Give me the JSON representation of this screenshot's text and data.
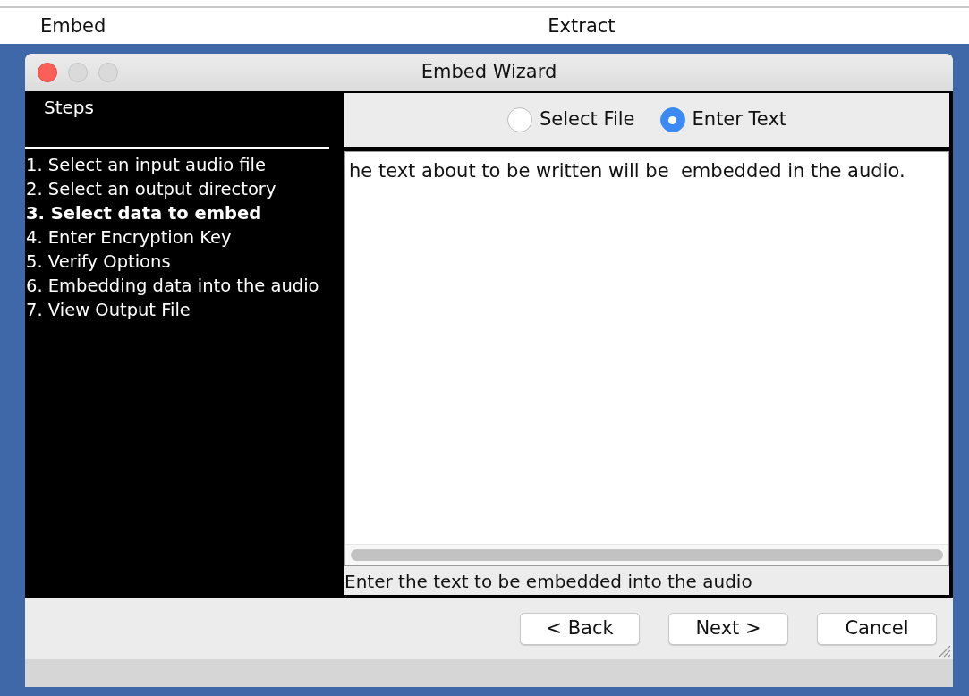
{
  "tabs": [
    {
      "label": "Embed"
    },
    {
      "label": "Extract"
    }
  ],
  "window": {
    "title": "Embed Wizard"
  },
  "sidebar": {
    "title": "Steps",
    "steps": [
      {
        "label": "1. Select an input audio file",
        "selected": false
      },
      {
        "label": "2. Select an output directory",
        "selected": false
      },
      {
        "label": "3. Select data to embed",
        "selected": true
      },
      {
        "label": "4. Enter Encryption Key",
        "selected": false
      },
      {
        "label": "5. Verify Options",
        "selected": false
      },
      {
        "label": "6. Embedding data into the audio",
        "selected": false
      },
      {
        "label": "7. View Output File",
        "selected": false
      }
    ]
  },
  "source_options": [
    {
      "label": "Select File",
      "selected": false
    },
    {
      "label": "Enter Text",
      "selected": true
    }
  ],
  "text_area": {
    "value": "he text about to be written will be  embedded in the audio."
  },
  "hint": "Enter the text to be embedded into the audio",
  "buttons": [
    "< Back",
    "Next >",
    "Cancel"
  ]
}
